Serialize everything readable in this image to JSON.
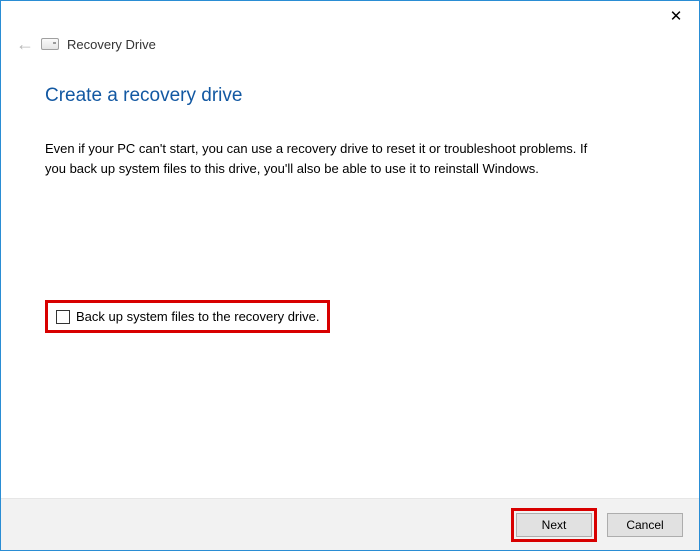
{
  "titlebar": {
    "close_glyph": "✕"
  },
  "header": {
    "back_glyph": "←",
    "title": "Recovery Drive"
  },
  "page": {
    "heading": "Create a recovery drive",
    "body": "Even if your PC can't start, you can use a recovery drive to reset it or troubleshoot problems. If you back up system files to this drive, you'll also be able to use it to reinstall Windows."
  },
  "option": {
    "checked": false,
    "label": "Back up system files to the recovery drive."
  },
  "footer": {
    "next_label": "Next",
    "cancel_label": "Cancel"
  },
  "highlights": {
    "accent_red": "#d80000"
  }
}
